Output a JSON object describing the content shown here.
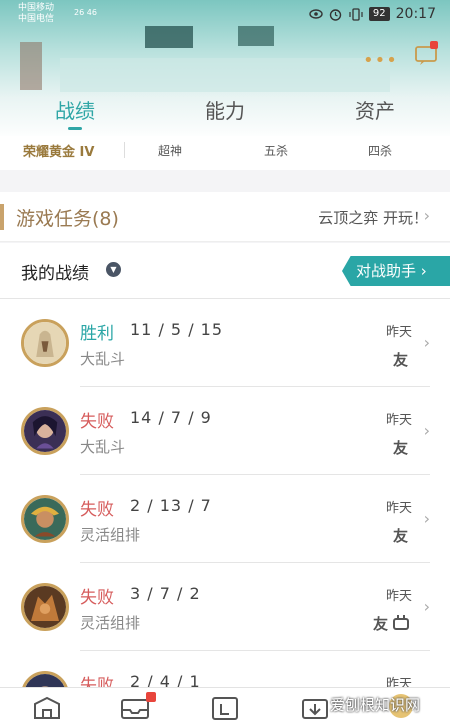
{
  "status": {
    "carrier1": "中国移动",
    "carrier2": "中国电信",
    "network1": "26",
    "network2": "46",
    "battery": "92",
    "time": "20:17"
  },
  "tabs": [
    "战绩",
    "能力",
    "资产"
  ],
  "ranks": {
    "tier": "荣耀黄金 IV",
    "legendary": "超神",
    "penta": "五杀",
    "quadra": "四杀"
  },
  "task": {
    "title": "游戏任务(8)",
    "link": "云顶之弈 开玩！"
  },
  "record": {
    "title": "我的战绩",
    "assistant": "对战助手"
  },
  "matches": [
    {
      "result": "胜利",
      "kda": "11 / 5 / 15",
      "mode": "大乱斗",
      "when": "昨天",
      "tag": "友"
    },
    {
      "result": "失败",
      "kda": "14 / 7 / 9",
      "mode": "大乱斗",
      "when": "昨天",
      "tag": "友"
    },
    {
      "result": "失败",
      "kda": "2 / 13 / 7",
      "mode": "灵活组排",
      "when": "昨天",
      "tag": "友"
    },
    {
      "result": "失败",
      "kda": "3 / 7 / 2",
      "mode": "灵活组排",
      "when": "昨天",
      "tag": "友"
    },
    {
      "result": "失败",
      "kda": "2 / 4 / 1",
      "mode": "",
      "when": "昨天",
      "tag": ""
    }
  ],
  "watermark": "爱刨根知识网",
  "colors": {
    "accent": "#2aa6a6",
    "win": "#2aa6a6",
    "lose": "#d65c5c",
    "gold": "#9a7a3d"
  }
}
